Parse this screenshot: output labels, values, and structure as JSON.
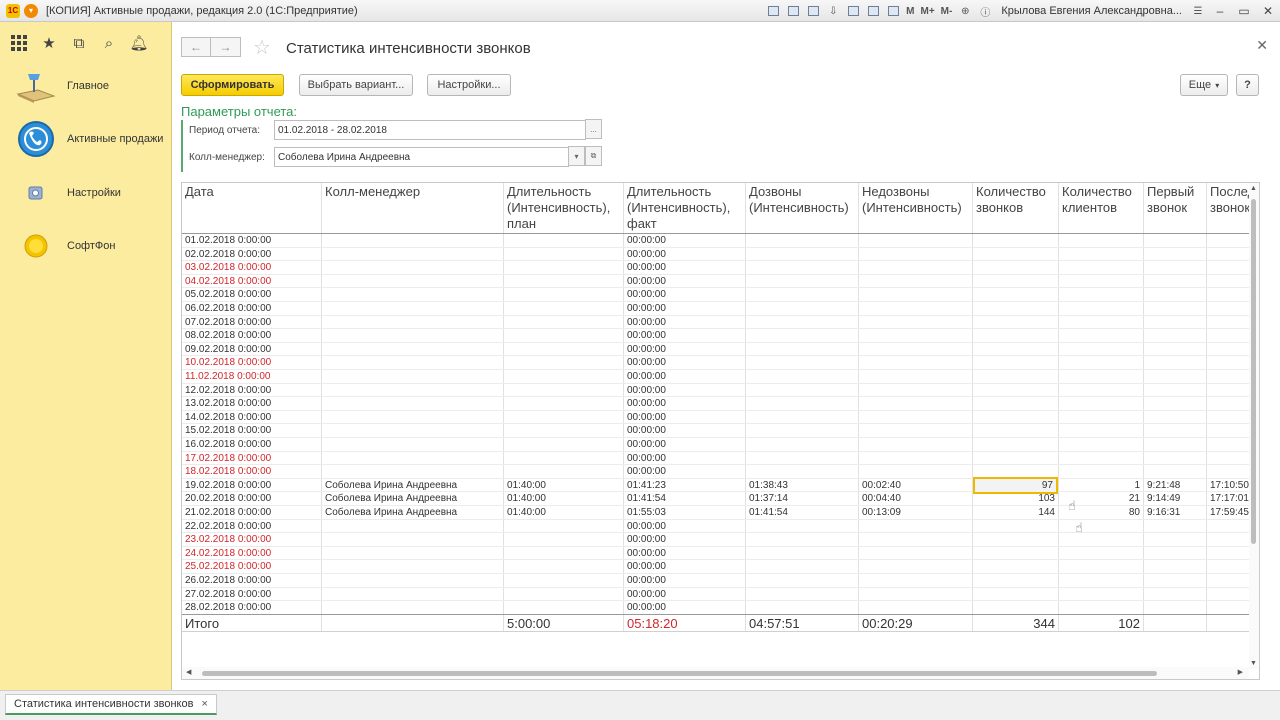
{
  "window": {
    "title": "[КОПИЯ] Активные продажи, редакция 2.0  (1С:Предприятие)",
    "logo": "1С",
    "toolbar_labels": [
      "M",
      "M+",
      "M-"
    ],
    "user": "Крылова Евгения Александровна..."
  },
  "sidebar": {
    "top_icons": [
      "apps-grid-icon",
      "star-icon",
      "history-icon",
      "search-icon",
      "bell-icon"
    ],
    "items": [
      {
        "label": "Главное",
        "icon": "desk-lamp-icon"
      },
      {
        "label": "Активные продажи",
        "icon": "phone-circle-icon"
      },
      {
        "label": "Настройки",
        "icon": "settings-icon"
      },
      {
        "label": "СофтФон",
        "icon": "softphone-icon"
      }
    ]
  },
  "header": {
    "title": "Статистика интенсивности звонков"
  },
  "toolbar": {
    "generate": "Сформировать",
    "choose_variant": "Выбрать вариант...",
    "settings": "Настройки...",
    "more": "Еще",
    "help": "?"
  },
  "params": {
    "title": "Параметры отчета:",
    "period_label": "Период отчета:",
    "period_value": "01.02.2018 - 28.02.2018",
    "period_button": "...",
    "manager_label": "Колл-менеджер:",
    "manager_value": "Соболева Ирина Андреевна"
  },
  "table": {
    "headers": [
      "Дата",
      "Колл-менеджер",
      "Длительность\n(Интенсивность),\nплан",
      "Длительность\n(Интенсивность),\nфакт",
      "Дозвоны\n(Интенсивность)",
      "Недозвоны\n(Интенсивность)",
      "Количество\nзвонков",
      "Количество\nклиентов",
      "Первый\nзвонок",
      "Последний\nзвонок"
    ],
    "rows": [
      {
        "date": "01.02.2018 0:00:00",
        "weekend": false,
        "manager": "",
        "plan": "",
        "fact": "00:00:00",
        "connected": "",
        "missed": "",
        "calls": "",
        "clients": "",
        "first": "",
        "last": ""
      },
      {
        "date": "02.02.2018 0:00:00",
        "weekend": false,
        "manager": "",
        "plan": "",
        "fact": "00:00:00",
        "connected": "",
        "missed": "",
        "calls": "",
        "clients": "",
        "first": "",
        "last": ""
      },
      {
        "date": "03.02.2018 0:00:00",
        "weekend": true,
        "manager": "",
        "plan": "",
        "fact": "00:00:00",
        "connected": "",
        "missed": "",
        "calls": "",
        "clients": "",
        "first": "",
        "last": ""
      },
      {
        "date": "04.02.2018 0:00:00",
        "weekend": true,
        "manager": "",
        "plan": "",
        "fact": "00:00:00",
        "connected": "",
        "missed": "",
        "calls": "",
        "clients": "",
        "first": "",
        "last": ""
      },
      {
        "date": "05.02.2018 0:00:00",
        "weekend": false,
        "manager": "",
        "plan": "",
        "fact": "00:00:00",
        "connected": "",
        "missed": "",
        "calls": "",
        "clients": "",
        "first": "",
        "last": ""
      },
      {
        "date": "06.02.2018 0:00:00",
        "weekend": false,
        "manager": "",
        "plan": "",
        "fact": "00:00:00",
        "connected": "",
        "missed": "",
        "calls": "",
        "clients": "",
        "first": "",
        "last": ""
      },
      {
        "date": "07.02.2018 0:00:00",
        "weekend": false,
        "manager": "",
        "plan": "",
        "fact": "00:00:00",
        "connected": "",
        "missed": "",
        "calls": "",
        "clients": "",
        "first": "",
        "last": ""
      },
      {
        "date": "08.02.2018 0:00:00",
        "weekend": false,
        "manager": "",
        "plan": "",
        "fact": "00:00:00",
        "connected": "",
        "missed": "",
        "calls": "",
        "clients": "",
        "first": "",
        "last": ""
      },
      {
        "date": "09.02.2018 0:00:00",
        "weekend": false,
        "manager": "",
        "plan": "",
        "fact": "00:00:00",
        "connected": "",
        "missed": "",
        "calls": "",
        "clients": "",
        "first": "",
        "last": ""
      },
      {
        "date": "10.02.2018 0:00:00",
        "weekend": true,
        "manager": "",
        "plan": "",
        "fact": "00:00:00",
        "connected": "",
        "missed": "",
        "calls": "",
        "clients": "",
        "first": "",
        "last": ""
      },
      {
        "date": "11.02.2018 0:00:00",
        "weekend": true,
        "manager": "",
        "plan": "",
        "fact": "00:00:00",
        "connected": "",
        "missed": "",
        "calls": "",
        "clients": "",
        "first": "",
        "last": ""
      },
      {
        "date": "12.02.2018 0:00:00",
        "weekend": false,
        "manager": "",
        "plan": "",
        "fact": "00:00:00",
        "connected": "",
        "missed": "",
        "calls": "",
        "clients": "",
        "first": "",
        "last": ""
      },
      {
        "date": "13.02.2018 0:00:00",
        "weekend": false,
        "manager": "",
        "plan": "",
        "fact": "00:00:00",
        "connected": "",
        "missed": "",
        "calls": "",
        "clients": "",
        "first": "",
        "last": ""
      },
      {
        "date": "14.02.2018 0:00:00",
        "weekend": false,
        "manager": "",
        "plan": "",
        "fact": "00:00:00",
        "connected": "",
        "missed": "",
        "calls": "",
        "clients": "",
        "first": "",
        "last": ""
      },
      {
        "date": "15.02.2018 0:00:00",
        "weekend": false,
        "manager": "",
        "plan": "",
        "fact": "00:00:00",
        "connected": "",
        "missed": "",
        "calls": "",
        "clients": "",
        "first": "",
        "last": ""
      },
      {
        "date": "16.02.2018 0:00:00",
        "weekend": false,
        "manager": "",
        "plan": "",
        "fact": "00:00:00",
        "connected": "",
        "missed": "",
        "calls": "",
        "clients": "",
        "first": "",
        "last": ""
      },
      {
        "date": "17.02.2018 0:00:00",
        "weekend": true,
        "manager": "",
        "plan": "",
        "fact": "00:00:00",
        "connected": "",
        "missed": "",
        "calls": "",
        "clients": "",
        "first": "",
        "last": ""
      },
      {
        "date": "18.02.2018 0:00:00",
        "weekend": true,
        "manager": "",
        "plan": "",
        "fact": "00:00:00",
        "connected": "",
        "missed": "",
        "calls": "",
        "clients": "",
        "first": "",
        "last": ""
      },
      {
        "date": "19.02.2018 0:00:00",
        "weekend": false,
        "manager": "Соболева Ирина Андреевна",
        "plan": "01:40:00",
        "fact": "01:41:23",
        "connected": "01:38:43",
        "missed": "00:02:40",
        "calls": "97",
        "clients": "1",
        "first": "9:21:48",
        "last": "17:10:50"
      },
      {
        "date": "20.02.2018 0:00:00",
        "weekend": false,
        "manager": "Соболева Ирина Андреевна",
        "plan": "01:40:00",
        "fact": "01:41:54",
        "connected": "01:37:14",
        "missed": "00:04:40",
        "calls": "103",
        "clients": "21",
        "first": "9:14:49",
        "last": "17:17:01"
      },
      {
        "date": "21.02.2018 0:00:00",
        "weekend": false,
        "manager": "Соболева Ирина Андреевна",
        "plan": "01:40:00",
        "fact": "01:55:03",
        "connected": "01:41:54",
        "missed": "00:13:09",
        "calls": "144",
        "clients": "80",
        "first": "9:16:31",
        "last": "17:59:45"
      },
      {
        "date": "22.02.2018 0:00:00",
        "weekend": false,
        "manager": "",
        "plan": "",
        "fact": "00:00:00",
        "connected": "",
        "missed": "",
        "calls": "",
        "clients": "",
        "first": "",
        "last": ""
      },
      {
        "date": "23.02.2018 0:00:00",
        "weekend": true,
        "manager": "",
        "plan": "",
        "fact": "00:00:00",
        "connected": "",
        "missed": "",
        "calls": "",
        "clients": "",
        "first": "",
        "last": ""
      },
      {
        "date": "24.02.2018 0:00:00",
        "weekend": true,
        "manager": "",
        "plan": "",
        "fact": "00:00:00",
        "connected": "",
        "missed": "",
        "calls": "",
        "clients": "",
        "first": "",
        "last": ""
      },
      {
        "date": "25.02.2018 0:00:00",
        "weekend": true,
        "manager": "",
        "plan": "",
        "fact": "00:00:00",
        "connected": "",
        "missed": "",
        "calls": "",
        "clients": "",
        "first": "",
        "last": ""
      },
      {
        "date": "26.02.2018 0:00:00",
        "weekend": false,
        "manager": "",
        "plan": "",
        "fact": "00:00:00",
        "connected": "",
        "missed": "",
        "calls": "",
        "clients": "",
        "first": "",
        "last": ""
      },
      {
        "date": "27.02.2018 0:00:00",
        "weekend": false,
        "manager": "",
        "plan": "",
        "fact": "00:00:00",
        "connected": "",
        "missed": "",
        "calls": "",
        "clients": "",
        "first": "",
        "last": ""
      },
      {
        "date": "28.02.2018 0:00:00",
        "weekend": false,
        "manager": "",
        "plan": "",
        "fact": "00:00:00",
        "connected": "",
        "missed": "",
        "calls": "",
        "clients": "",
        "first": "",
        "last": ""
      }
    ],
    "totals": {
      "label": "Итого",
      "plan": "5:00:00",
      "fact": "05:18:20",
      "connected": "04:57:51",
      "missed": "00:20:29",
      "calls": "344",
      "clients": "102"
    }
  },
  "tabs": [
    {
      "label": "Статистика интенсивности звонков",
      "close": "×"
    }
  ],
  "colors": {
    "sidebar_bg": "#fbeca0",
    "primary_button": "#f6cc00",
    "params_title": "#2f9a55",
    "weekend_text": "#d2262b",
    "selected_cell_border": "#f0b800"
  }
}
